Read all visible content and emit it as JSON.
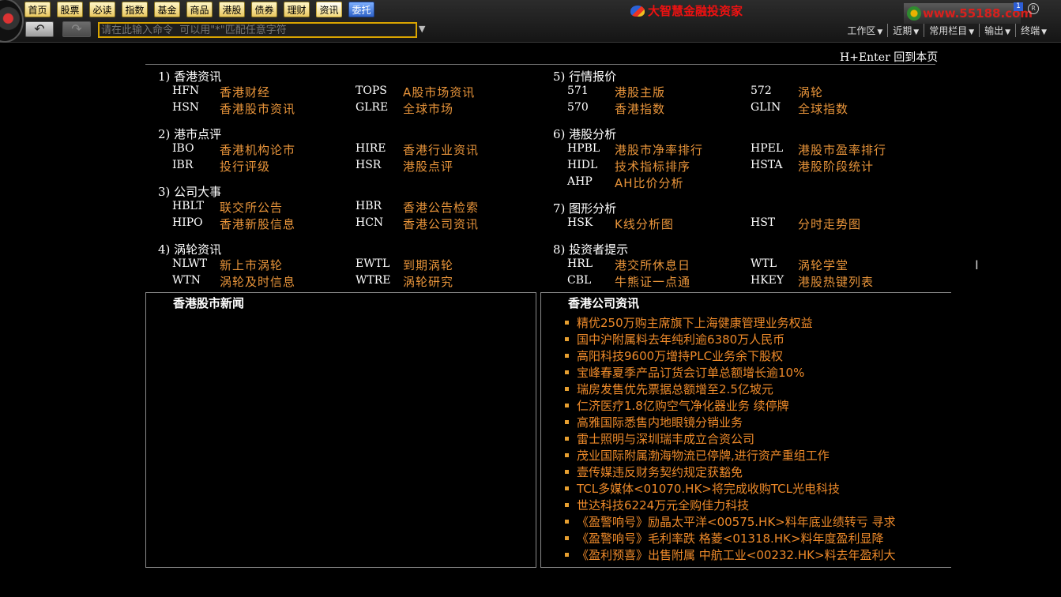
{
  "toolbar": {
    "nav_buttons": [
      "首页",
      "股票",
      "必读",
      "指数",
      "基金",
      "商品",
      "港股",
      "债券",
      "理财",
      "资讯",
      "委托"
    ],
    "command_placeholder": "请在此输入命令  可以用\"*\"匹配任意字符",
    "brand": "大智慧金融投资家",
    "site": "www.55188.com",
    "badge": "1",
    "menus": [
      "工作区",
      "近期",
      "常用栏目",
      "输出",
      "终端"
    ]
  },
  "header": {
    "return_hint": "H+Enter 回到本页"
  },
  "sections": [
    {
      "title": "1) 香港资讯",
      "items": [
        {
          "code": "HFN",
          "label": "香港财经"
        },
        {
          "code": "TOPS",
          "label": "A股市场资讯"
        },
        {
          "code": "HSN",
          "label": "香港股市资讯"
        },
        {
          "code": "GLRE",
          "label": "全球市场"
        }
      ]
    },
    {
      "title": "2) 港市点评",
      "items": [
        {
          "code": "IBO",
          "label": "香港机构论市"
        },
        {
          "code": "HIRE",
          "label": "香港行业资讯"
        },
        {
          "code": "IBR",
          "label": "投行评级"
        },
        {
          "code": "HSR",
          "label": "港股点评"
        }
      ]
    },
    {
      "title": "3) 公司大事",
      "items": [
        {
          "code": "HBLT",
          "label": "联交所公告"
        },
        {
          "code": "HBR",
          "label": "香港公告检索"
        },
        {
          "code": "HIPO",
          "label": "香港新股信息"
        },
        {
          "code": "HCN",
          "label": "香港公司资讯"
        }
      ]
    },
    {
      "title": "4) 涡轮资讯",
      "items": [
        {
          "code": "NLWT",
          "label": "新上市涡轮"
        },
        {
          "code": "EWTL",
          "label": "到期涡轮"
        },
        {
          "code": "WTN",
          "label": "涡轮及时信息"
        },
        {
          "code": "WTRE",
          "label": "涡轮研究"
        }
      ]
    },
    {
      "title": "5) 行情报价",
      "items": [
        {
          "code": "571",
          "label": "港股主版"
        },
        {
          "code": "572",
          "label": "涡轮"
        },
        {
          "code": "570",
          "label": "香港指数"
        },
        {
          "code": "GLIN",
          "label": "全球指数"
        }
      ]
    },
    {
      "title": "6) 港股分析",
      "items": [
        {
          "code": "HPBL",
          "label": "港股市净率排行"
        },
        {
          "code": "HPEL",
          "label": "港股市盈率排行"
        },
        {
          "code": "HIDL",
          "label": "技术指标排序"
        },
        {
          "code": "HSTA",
          "label": "港股阶段统计"
        },
        {
          "code": "AHP",
          "label": "AH比价分析"
        }
      ]
    },
    {
      "title": "7) 图形分析",
      "items": [
        {
          "code": "HSK",
          "label": "K线分析图"
        },
        {
          "code": "HST",
          "label": "分时走势图"
        }
      ]
    },
    {
      "title": "8) 投资者提示",
      "items": [
        {
          "code": "HRL",
          "label": "港交所休息日"
        },
        {
          "code": "WTL",
          "label": "涡轮学堂"
        },
        {
          "code": "CBL",
          "label": "牛熊证一点通"
        },
        {
          "code": "HKEY",
          "label": "港股热键列表"
        }
      ]
    }
  ],
  "panels": {
    "left_title": "香港股市新闻",
    "right_title": "香港公司资讯",
    "news": [
      "精优250万购主席旗下上海健康管理业务权益",
      "国中沪附属料去年纯利逾6380万人民币",
      "高阳科技9600万增持PLC业务余下股权",
      "宝峰春夏季产品订货会订单总额增长逾10%",
      "瑞房发售优先票据总额增至2.5亿坡元",
      "仁济医疗1.8亿购空气净化器业务 续停牌",
      "高雅国际悉售内地眼镜分销业务",
      "雷士照明与深圳瑞丰成立合资公司",
      "茂业国际附属渤海物流已停牌,进行资产重组工作",
      "壹传媒违反财务契约规定获豁免",
      "TCL多媒体<01070.HK>将完成收购TCL光电科技",
      "世达科技6224万元全购佳力科技",
      "《盈警响号》励晶太平洋<00575.HK>料年底业绩转亏  寻求",
      "《盈警响号》毛利率跌  格菱<01318.HK>料年度盈利显降",
      "《盈利预喜》出售附属  中航工业<00232.HK>料去年盈利大"
    ]
  }
}
